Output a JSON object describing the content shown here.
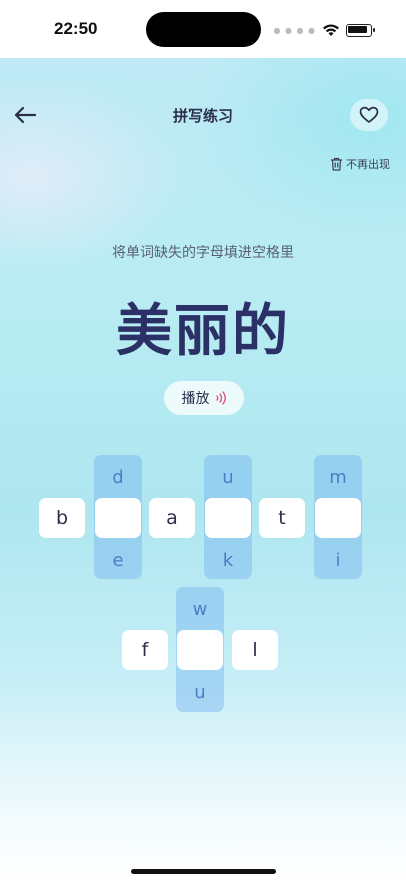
{
  "status": {
    "time": "22:50"
  },
  "header": {
    "title": "拼写练习"
  },
  "actions": {
    "no_more_label": "不再出现"
  },
  "exercise": {
    "instruction": "将单词缺失的字母填进空格里",
    "meaning": "美丽的",
    "play_label": "播放",
    "row1": {
      "letters": [
        "b",
        "a",
        "t"
      ],
      "options": [
        [
          "d",
          "e"
        ],
        [
          "u",
          "k"
        ],
        [
          "m",
          "i"
        ]
      ]
    },
    "row2": {
      "letters": [
        "f",
        "l"
      ],
      "options": [
        [
          "w",
          "u"
        ]
      ]
    }
  },
  "colors": {
    "accent": "#2b3166",
    "option": "#4a7fc8",
    "sound": "#e0567a"
  }
}
